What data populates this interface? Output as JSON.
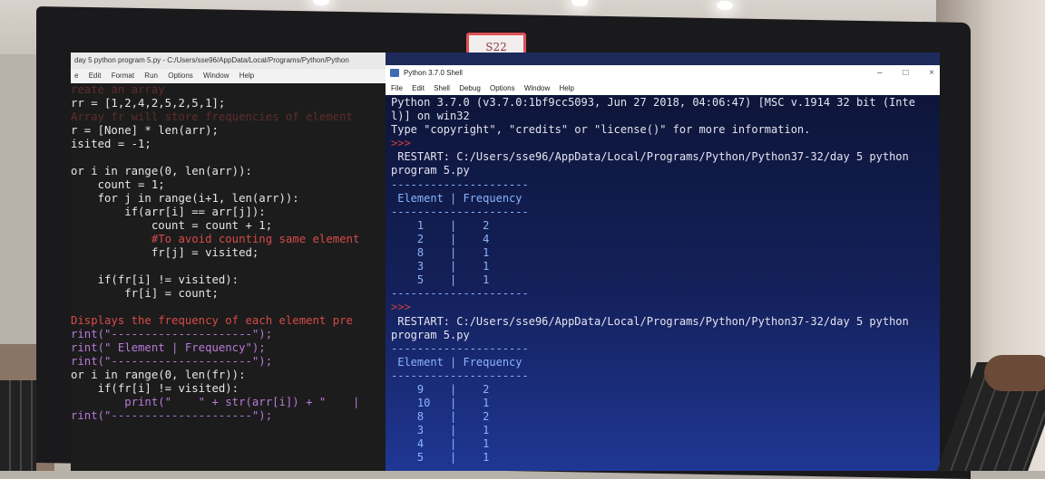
{
  "sticker": "S22",
  "editor": {
    "title": "day 5 python program 5.py - C:/Users/sse96/AppData/Local/Programs/Python/Python",
    "menu": [
      "e",
      "Edit",
      "Format",
      "Run",
      "Options",
      "Window",
      "Help"
    ]
  },
  "shell": {
    "title": "Python 3.7.0 Shell",
    "window_controls": [
      "–",
      "□",
      "×"
    ],
    "menu": [
      "File",
      "Edit",
      "Shell",
      "Debug",
      "Options",
      "Window",
      "Help"
    ],
    "lines": [
      "Python 3.7.0 (v3.7.0:1bf9cc5093, Jun 27 2018, 04:06:47) [MSC v.1914 32 bit (Inte",
      "l)] on win32",
      "Type \"copyright\", \"credits\" or \"license()\" for more information.",
      ">>>",
      " RESTART: C:/Users/sse96/AppData/Local/Programs/Python/Python37-32/day 5 python",
      "program 5.py",
      "---------------------",
      " Element | Frequency",
      "---------------------",
      "    1    |    2",
      "    2    |    4",
      "    8    |    1",
      "    3    |    1",
      "    5    |    1",
      "---------------------",
      ">>>",
      " RESTART: C:/Users/sse96/AppData/Local/Programs/Python/Python37-32/day 5 python",
      "program 5.py",
      "---------------------",
      " Element | Frequency",
      "---------------------",
      "    9    |    2",
      "    10   |    1",
      "    8    |    2",
      "    3    |    1",
      "    4    |    1",
      "    5    |    1",
      "---------------------"
    ]
  },
  "code_lines": [
    "reate an array",
    "rr = [1,2,4,2,5,2,5,1];",
    "Array fr will store frequencies of element",
    "r = [None] * len(arr);",
    "isited = -1;",
    "",
    "or i in range(0, len(arr)):",
    "    count = 1;",
    "    for j in range(i+1, len(arr)):",
    "        if(arr[i] == arr[j]):",
    "            count = count + 1;",
    "            #To avoid counting same element",
    "            fr[j] = visited;",
    "",
    "    if(fr[i] != visited):",
    "        fr[i] = count;",
    "",
    "Displays the frequency of each element pre",
    "rint(\"---------------------\");",
    "rint(\" Element | Frequency\");",
    "rint(\"---------------------\");",
    "or i in range(0, len(fr)):",
    "    if(fr[i] != visited):",
    "        print(\"    \" + str(arr[i]) + \"    |",
    "rint(\"---------------------\");"
  ]
}
